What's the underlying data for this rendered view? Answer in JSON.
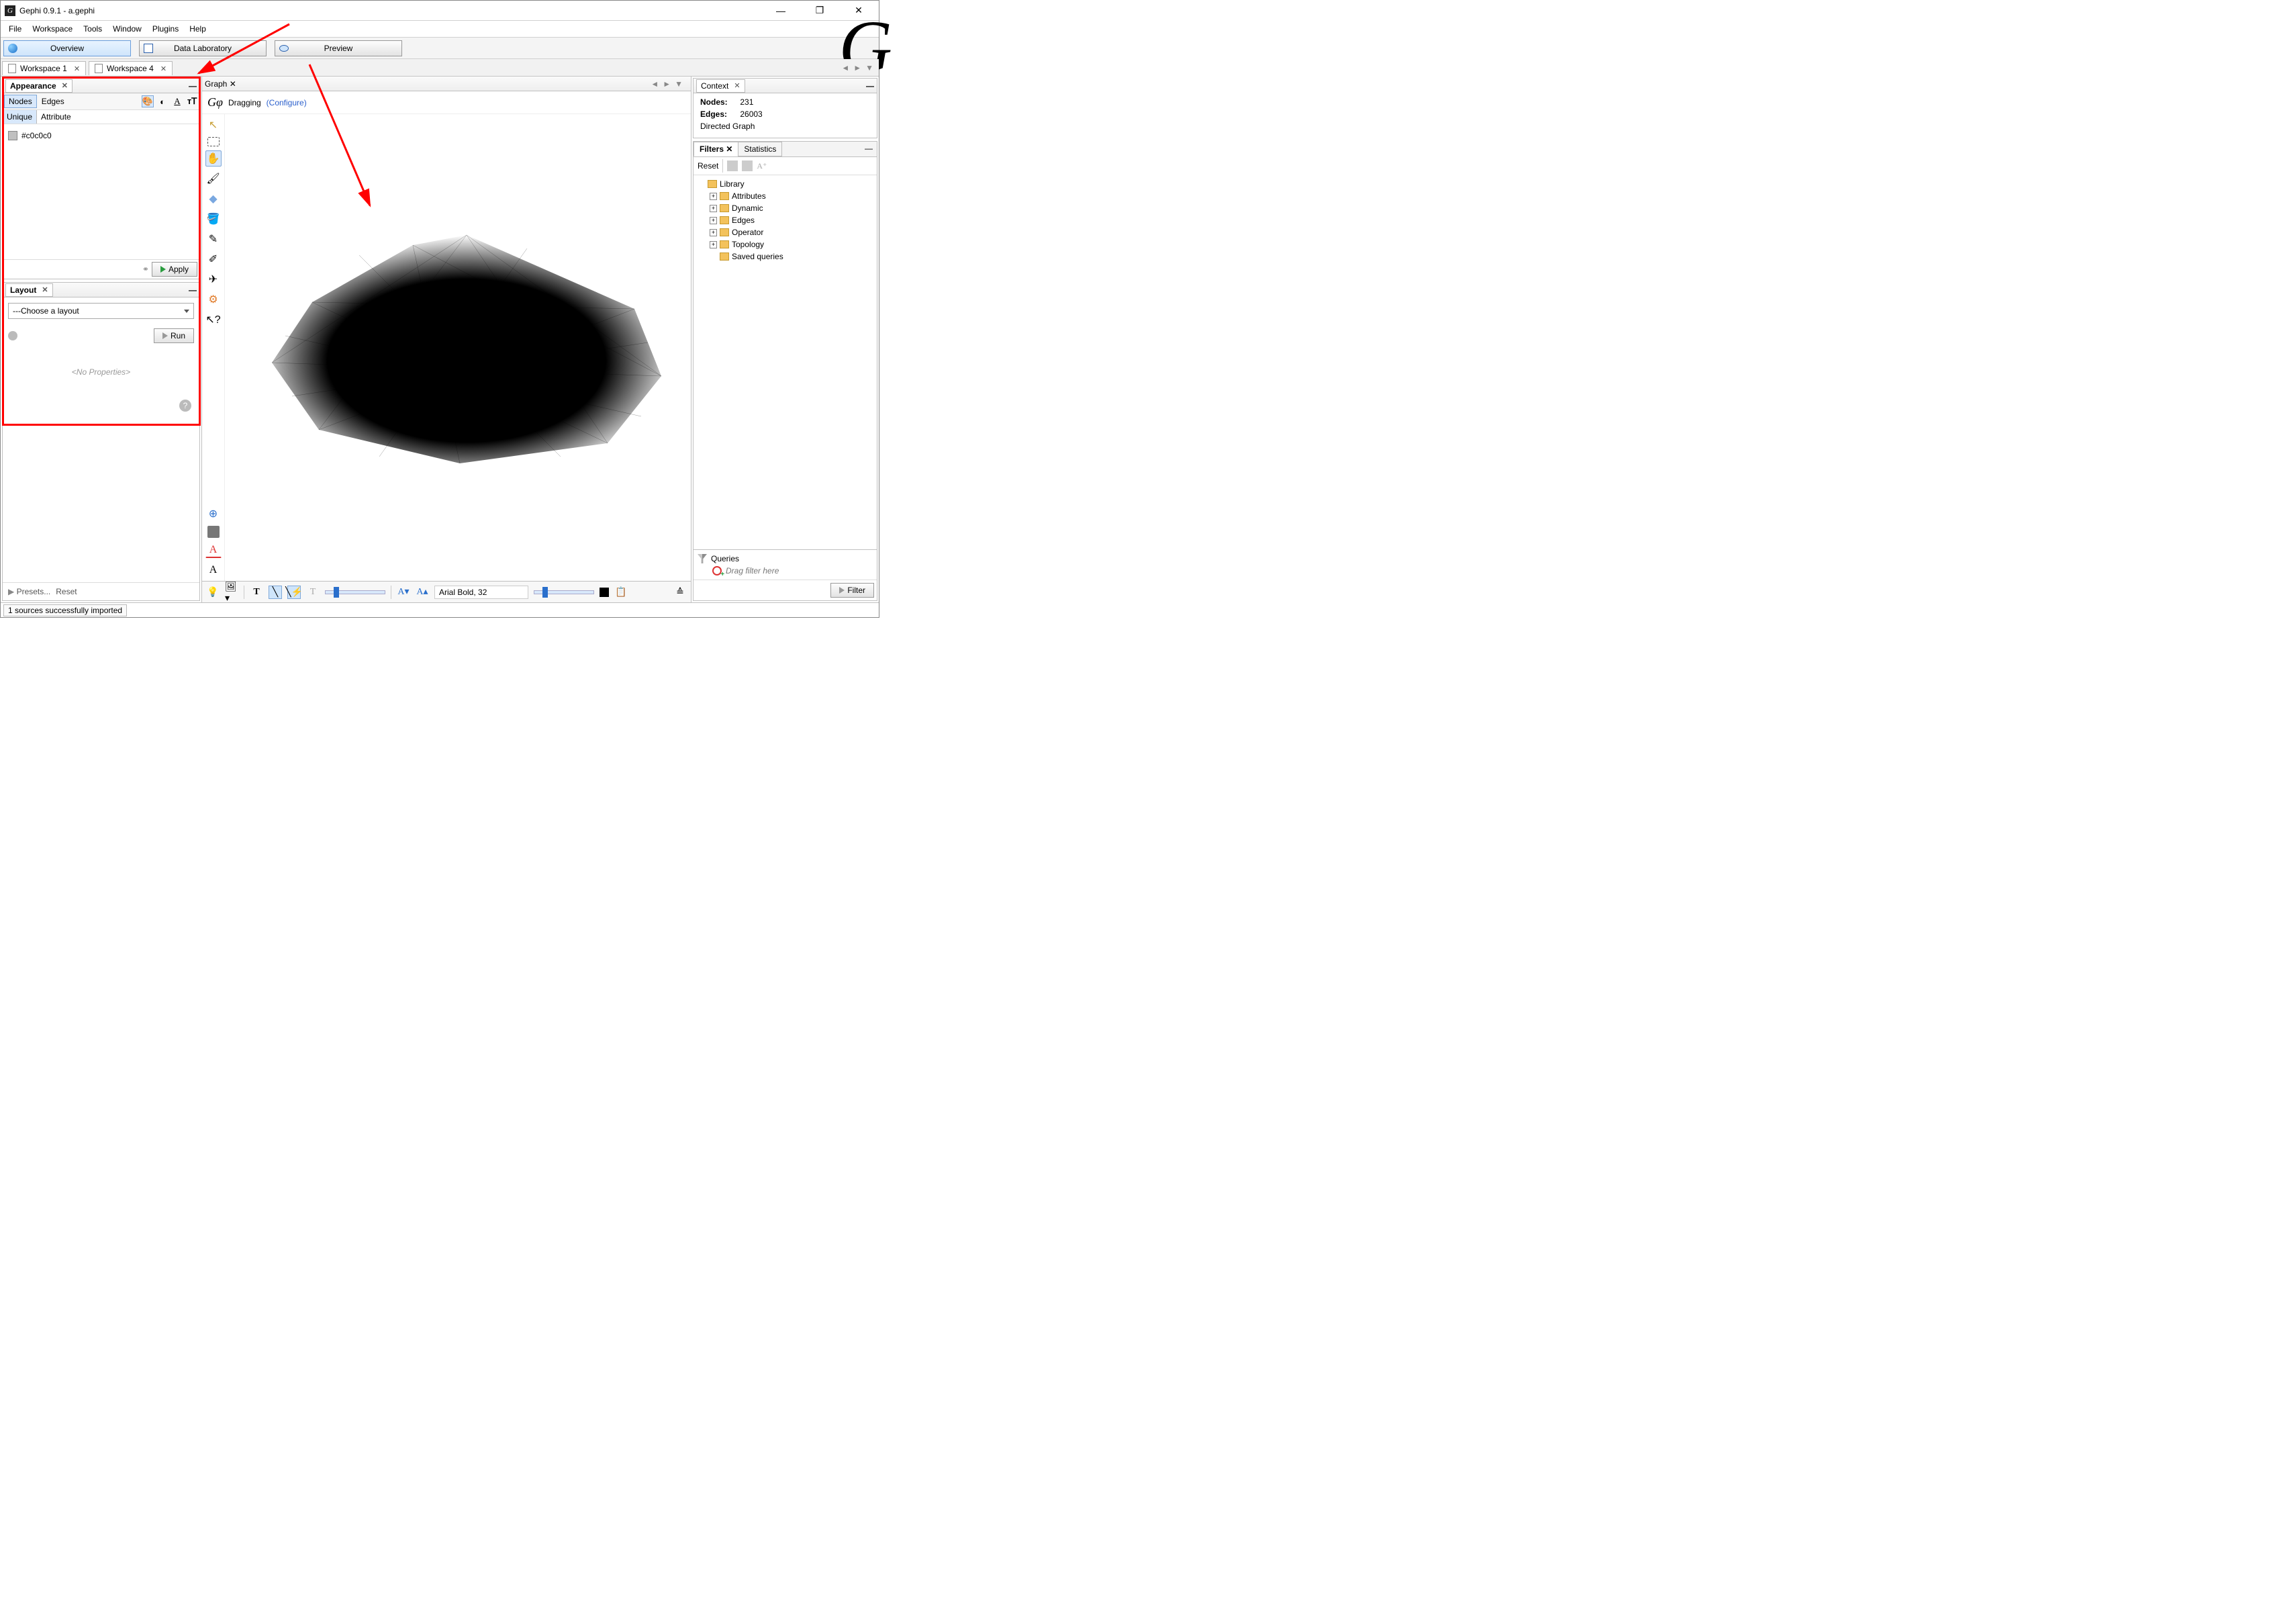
{
  "title": "Gephi 0.9.1 - a.gephi",
  "menu": {
    "file": "File",
    "workspace": "Workspace",
    "tools": "Tools",
    "window": "Window",
    "plugins": "Plugins",
    "help": "Help"
  },
  "views": {
    "overview": "Overview",
    "datalab": "Data Laboratory",
    "preview": "Preview"
  },
  "workspaces": {
    "w1": "Workspace 1",
    "w4": "Workspace 4"
  },
  "appearance": {
    "title": "Appearance",
    "tab_nodes": "Nodes",
    "tab_edges": "Edges",
    "mode_unique": "Unique",
    "mode_attribute": "Attribute",
    "color_hex": "#c0c0c0",
    "apply": "Apply"
  },
  "layout": {
    "title": "Layout",
    "choose": "---Choose a layout",
    "run": "Run",
    "noprops": "<No Properties>",
    "presets": "Presets...",
    "reset": "Reset"
  },
  "graph": {
    "title": "Graph",
    "dragging": "Dragging",
    "configure": "(Configure)",
    "font": "Arial Bold, 32"
  },
  "context": {
    "title": "Context",
    "nodes_label": "Nodes:",
    "nodes_val": "231",
    "edges_label": "Edges:",
    "edges_val": "26003",
    "type": "Directed Graph"
  },
  "filters": {
    "tab_filters": "Filters",
    "tab_stats": "Statistics",
    "reset": "Reset",
    "library": "Library",
    "attributes": "Attributes",
    "dynamic": "Dynamic",
    "edges": "Edges",
    "operator": "Operator",
    "topology": "Topology",
    "saved": "Saved queries",
    "queries": "Queries",
    "drag_here": "Drag filter here",
    "filter_btn": "Filter"
  },
  "status": "1 sources successfully imported"
}
